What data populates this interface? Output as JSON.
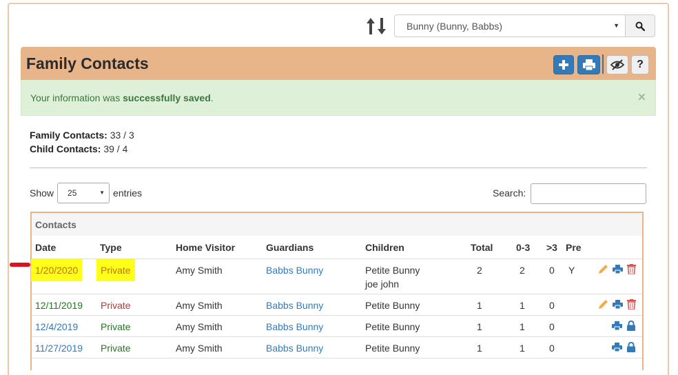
{
  "selector": {
    "value": "Bunny (Bunny, Babbs)"
  },
  "header": {
    "title": "Family Contacts"
  },
  "alert": {
    "prefix": "Your information was ",
    "strong": "successfully saved",
    "suffix": ".",
    "close": "×"
  },
  "counts": {
    "family_label": "Family Contacts:",
    "family_value": "33 / 3",
    "child_label": "Child Contacts:",
    "child_value": "39 / 4"
  },
  "length": {
    "show": "Show",
    "value": "25",
    "entries": "entries"
  },
  "search": {
    "label": "Search:"
  },
  "table": {
    "caption": "Contacts",
    "headers": [
      "Date",
      "Type",
      "Home Visitor",
      "Guardians",
      "Children",
      "Total",
      "0-3",
      ">3",
      "Pre"
    ],
    "rows": [
      {
        "date": "1/20/2020",
        "type": "Private",
        "visitor": "Amy Smith",
        "guardians": "Babbs Bunny",
        "child1": "Petite Bunny",
        "child2": "joe john",
        "total": "2",
        "c03": "2",
        "gt3": "0",
        "pre": "Y"
      },
      {
        "date": "12/11/2019",
        "type": "Private",
        "visitor": "Amy Smith",
        "guardians": "Babbs Bunny",
        "child1": "Petite Bunny",
        "total": "1",
        "c03": "1",
        "gt3": "0",
        "pre": ""
      },
      {
        "date": "12/4/2019",
        "type": "Private",
        "visitor": "Amy Smith",
        "guardians": "Babbs Bunny",
        "child1": "Petite Bunny",
        "total": "1",
        "c03": "1",
        "gt3": "0",
        "pre": ""
      },
      {
        "date": "11/27/2019",
        "type": "Private",
        "visitor": "Amy Smith",
        "guardians": "Babbs Bunny",
        "child1": "Petite Bunny",
        "total": "1",
        "c03": "1",
        "gt3": "0",
        "pre": ""
      }
    ]
  },
  "colors": {
    "accent": "#e8b48a",
    "primary": "#337ab7",
    "success_bg": "#dff0d8",
    "highlight": "#ffff1a",
    "danger": "#c9302c"
  },
  "icons": [
    "sort-icon",
    "search-icon",
    "plus-icon",
    "print-icon",
    "eye-slash-icon",
    "help-icon",
    "close-icon",
    "pencil-icon",
    "trash-icon",
    "lock-icon"
  ]
}
